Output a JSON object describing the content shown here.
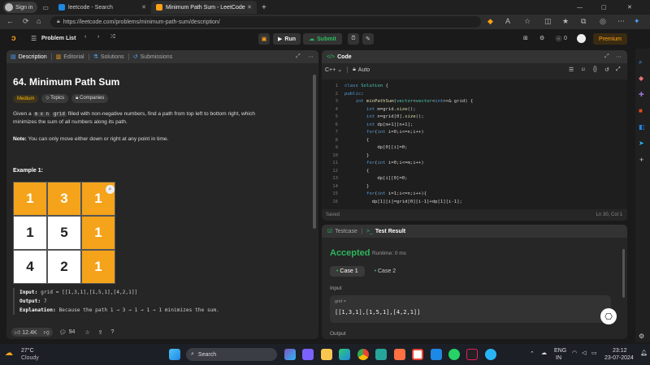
{
  "browser": {
    "signin": "Sign in",
    "tabs": [
      {
        "title": "leetcode - Search"
      },
      {
        "title": "Minimum Path Sum - LeetCode"
      }
    ],
    "url": "https://leetcode.com/problems/minimum-path-sum/description/"
  },
  "nav": {
    "problem_list": "Problem List",
    "run": "Run",
    "submit": "Submit",
    "streak": "0",
    "premium": "Premium"
  },
  "left": {
    "tabs": {
      "description": "Description",
      "editorial": "Editorial",
      "solutions": "Solutions",
      "submissions": "Submissions"
    },
    "title": "64. Minimum Path Sum",
    "difficulty": "Medium",
    "topics": "Topics",
    "companies": "Companies",
    "desc1_a": "Given a",
    "desc1_code1": "m x n",
    "desc1_code2": "grid",
    "desc1_b": "filled with non-negative numbers, find a path from top left to bottom right, which",
    "desc1_c": "minimizes the sum of all numbers along its path.",
    "note_label": "Note:",
    "note_text": "You can only move either down or right at any point in time.",
    "example_title": "Example 1:",
    "grid": [
      [
        "1",
        "3",
        "1"
      ],
      [
        "1",
        "5",
        "1"
      ],
      [
        "4",
        "2",
        "1"
      ]
    ],
    "input_label": "Input:",
    "input_value": "grid = [[1,3,1],[1,5,1],[4,2,1]]",
    "output_label": "Output:",
    "output_value": "7",
    "explanation_label": "Explanation:",
    "explanation_value": "Because the path 1 → 3 → 1 → 1 → 1 minimizes the sum.",
    "likes": "12.4K",
    "comments": "94"
  },
  "code": {
    "title": "Code",
    "language": "C++",
    "auto": "Auto",
    "saved": "Saved",
    "cursor": "Ln 30, Col 1",
    "lines": [
      {
        "n": "1",
        "t": "class Solution {"
      },
      {
        "n": "2",
        "t": "public:"
      },
      {
        "n": "3",
        "t": "    int minPathSum(vector<vector<int>>& grid) {"
      },
      {
        "n": "4",
        "t": "        int m=grid.size();"
      },
      {
        "n": "5",
        "t": "        int n=grid[0].size();"
      },
      {
        "n": "6",
        "t": "        int dp[m+1][n+1];"
      },
      {
        "n": "7",
        "t": "        for(int i=0;i<=n;i++)"
      },
      {
        "n": "8",
        "t": "        {"
      },
      {
        "n": "9",
        "t": "            dp[0][i]=0;"
      },
      {
        "n": "10",
        "t": "        }"
      },
      {
        "n": "11",
        "t": "        for(int i=0;i<=m;i++)"
      },
      {
        "n": "12",
        "t": "        {"
      },
      {
        "n": "13",
        "t": "            dp[i][0]=0;"
      },
      {
        "n": "14",
        "t": "        }"
      },
      {
        "n": "15",
        "t": "        for(int i=1;i<=n;i++){"
      },
      {
        "n": "16",
        "t": "          dp[1][i]=grid[0][i-1]+dp[1][i-1];"
      }
    ]
  },
  "result": {
    "testcase_tab": "Testcase",
    "result_tab": "Test Result",
    "status": "Accepted",
    "runtime": "Runtime: 0 ms",
    "case1": "Case 1",
    "case2": "Case 2",
    "input_label": "Input",
    "var_name": "grid =",
    "var_value": "[[1,3,1],[1,5,1],[4,2,1]]",
    "output_label": "Output"
  },
  "taskbar": {
    "temp": "27°C",
    "weather": "Cloudy",
    "search": "Search",
    "lang1": "ENG",
    "lang2": "IN",
    "time": "23:12",
    "date": "23-07-2024"
  },
  "colors": {
    "accent": "#ffa116",
    "green": "#2cbb5d",
    "accepted": "#2db55d",
    "medium": "#ffb800"
  }
}
